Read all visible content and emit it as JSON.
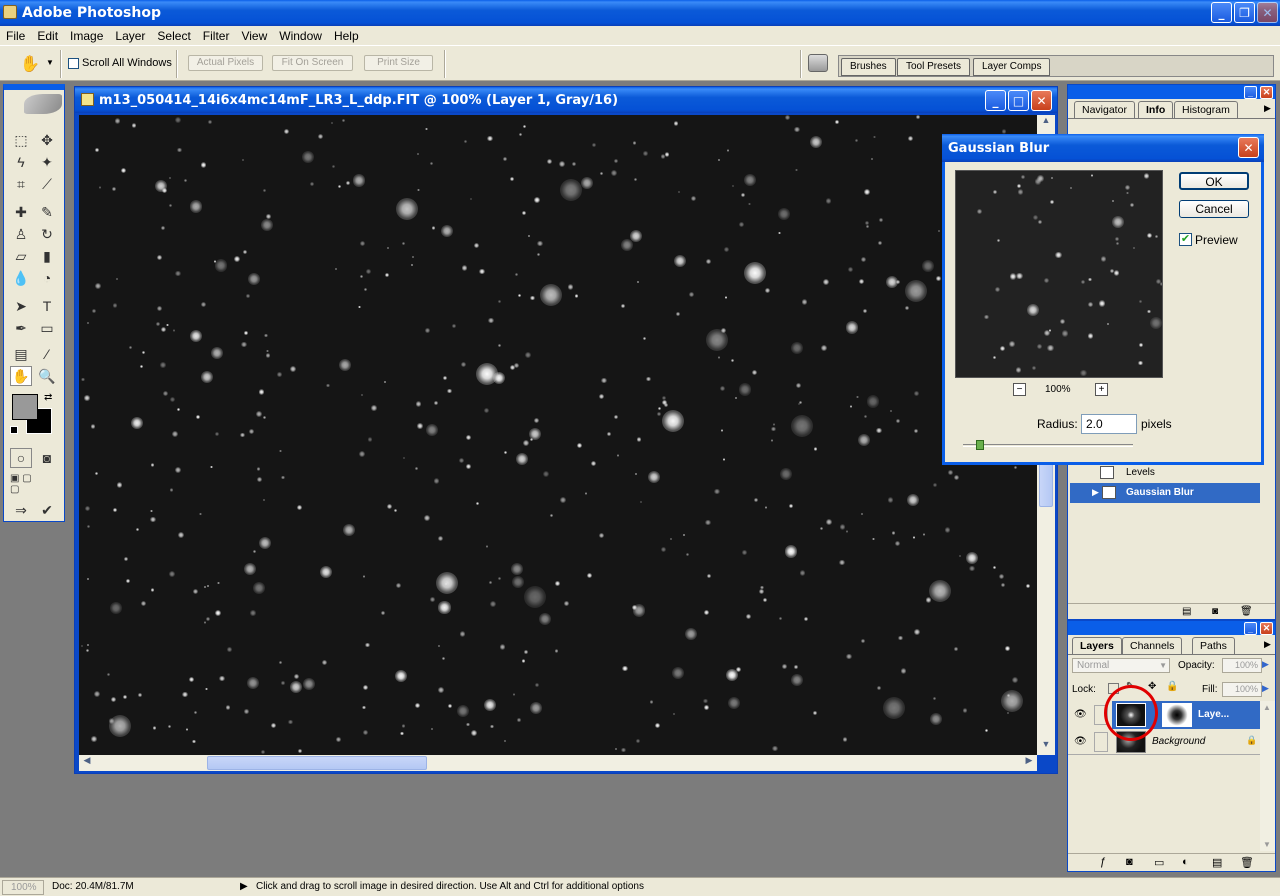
{
  "app": {
    "title": "Adobe Photoshop"
  },
  "menu": [
    "File",
    "Edit",
    "Image",
    "Layer",
    "Select",
    "Filter",
    "View",
    "Window",
    "Help"
  ],
  "options": {
    "scroll_all_label": "Scroll All Windows",
    "actual_pixels": "Actual Pixels",
    "fit_on_screen": "Fit On Screen",
    "print_size": "Print Size"
  },
  "palette_well": [
    "Brushes",
    "Tool Presets",
    "Layer Comps"
  ],
  "document": {
    "title": "m13_050414_14i6x4mc14mF_LR3_L_ddp.FIT @ 100% (Layer 1, Gray/16)"
  },
  "dialog": {
    "title": "Gaussian Blur",
    "ok": "OK",
    "cancel": "Cancel",
    "preview_label": "Preview",
    "zoom": "100%",
    "radius_label": "Radius:",
    "radius_value": "2.0",
    "radius_unit": "pixels",
    "slider_level": 0.1
  },
  "nav_panel": {
    "tabs": [
      "Navigator",
      "Info",
      "Histogram"
    ],
    "active": "Info"
  },
  "history": {
    "items": [
      "Levels",
      "Gaussian Blur"
    ],
    "selected": "Gaussian Blur"
  },
  "layers_panel": {
    "tabs": [
      "Layers",
      "Channels",
      "Paths"
    ],
    "blend_mode": "Normal",
    "opacity_label": "Opacity:",
    "opacity_value": "100%",
    "lock_label": "Lock:",
    "fill_label": "Fill:",
    "fill_value": "100%",
    "layers": [
      {
        "name": "Laye...",
        "selected": true
      },
      {
        "name": "Background",
        "selected": false
      }
    ]
  },
  "status": {
    "zoom": "100%",
    "doc": "Doc: 20.4M/81.7M",
    "hint": "Click and drag to scroll image in desired direction.  Use Alt and Ctrl for additional options"
  },
  "colors": {
    "title_blue": "#0a5ee8",
    "selection": "#316ac5",
    "highlight_circle": "#e00000"
  }
}
